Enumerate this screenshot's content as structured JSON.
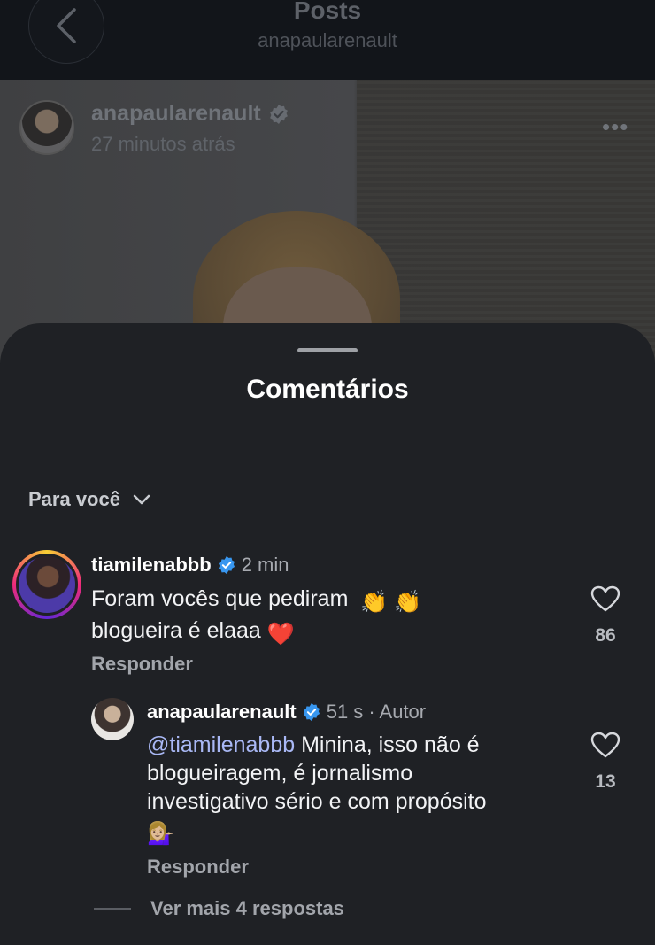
{
  "header": {
    "title": "Posts",
    "subtitle": "anapaularenault"
  },
  "post": {
    "username": "anapaularenault",
    "time": "27 minutos atrás"
  },
  "sheet": {
    "title": "Comentários",
    "filter_label": "Para você"
  },
  "comments": [
    {
      "username": "tiamilenabbb",
      "time": "2 min",
      "text_line1": "Foram vocês que pediram",
      "text_line2": "blogueira é elaaa",
      "reply_label": "Responder",
      "likes": "86"
    },
    {
      "username": "anapaularenault",
      "time": "51 s",
      "author_tag": "· Autor",
      "mention": "@tiamilenabbb",
      "text_line1": " Minina, isso não é",
      "text_line2": "blogueiragem, é jornalismo",
      "text_line3": "investigativo sério e com propósito",
      "reply_label": "Responder",
      "likes": "13"
    }
  ],
  "more_replies_label": "Ver mais 4 respostas",
  "colors": {
    "verified": "#3897f0",
    "mention": "#a9b8f5",
    "sheet_bg": "#1f2125"
  },
  "icons": [
    "back-chevron-icon",
    "verified-badge-icon",
    "more-dots-icon",
    "chevron-down-icon",
    "heart-icon",
    "clapping-hands-emoji",
    "red-heart-emoji",
    "shrug-emoji"
  ]
}
